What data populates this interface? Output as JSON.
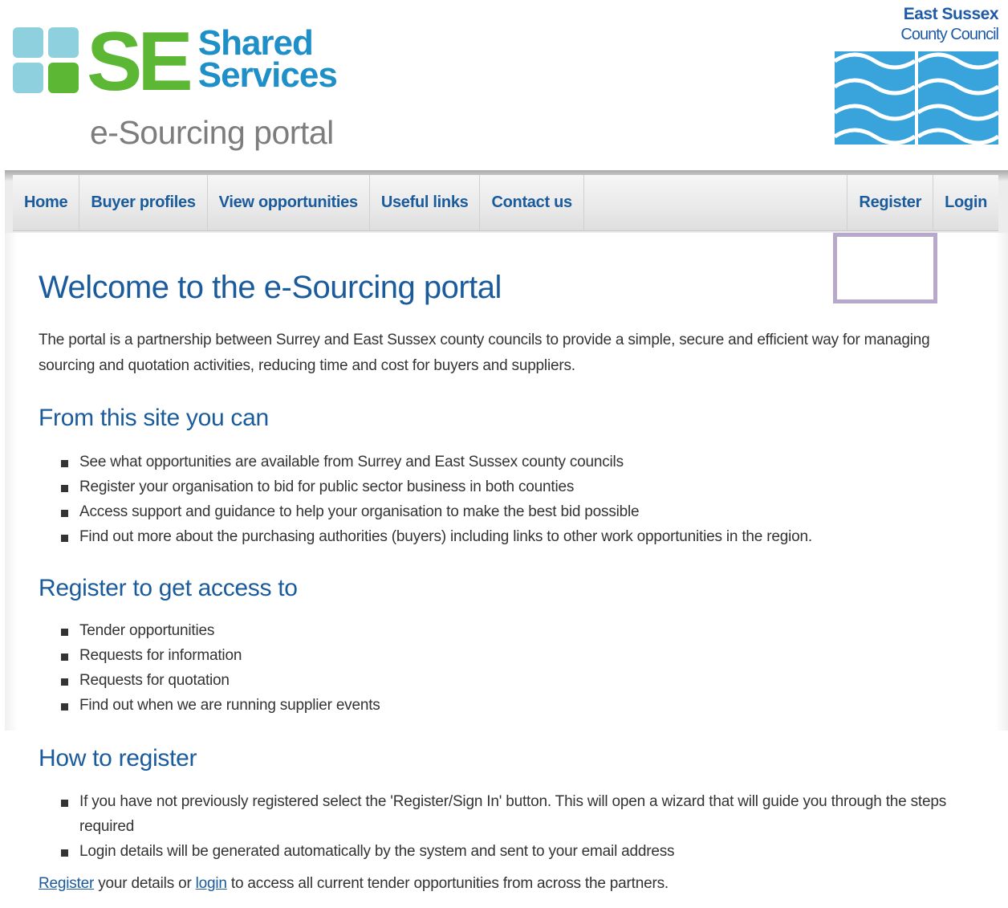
{
  "header": {
    "logo_letters": "SE",
    "logo_word1": "Shared",
    "logo_word2": "Services",
    "subtitle": "e-Sourcing portal",
    "partner_name_line1": "East Sussex",
    "partner_name_line2": "County Council"
  },
  "nav": {
    "left": [
      "Home",
      "Buyer profiles",
      "View opportunities",
      "Useful links",
      "Contact us"
    ],
    "right": [
      "Register",
      "Login"
    ]
  },
  "main": {
    "title": "Welcome to the e-Sourcing portal",
    "intro": "The portal is a partnership between Surrey and East Sussex county councils to provide a simple, secure and efficient way for managing sourcing and quotation activities, reducing time and cost for buyers and suppliers.",
    "sections": [
      {
        "heading": "From this site you can",
        "items": [
          "See what opportunities are available from Surrey and East Sussex county councils",
          "Register your organisation to bid for public sector business in both counties",
          "Access support and guidance to help your organisation to make the best bid possible",
          "Find out more about the purchasing authorities (buyers) including links to other work opportunities in the region."
        ]
      },
      {
        "heading": "Register to get access to",
        "items": [
          "Tender opportunities",
          "Requests for information",
          "Requests for quotation",
          "Find out when we are running supplier events"
        ]
      },
      {
        "heading": "How to register",
        "items": [
          "If you have not previously registered select the 'Register/Sign In' button. This will open a wizard that will guide you through the steps required",
          "Login details will be generated automatically by the system and sent to your email address"
        ]
      }
    ],
    "footer": {
      "register_link": "Register",
      "middle_text": " your details or ",
      "login_link": "login",
      "end_text": " to access all current tender opportunities from across the partners."
    }
  },
  "colors": {
    "brand_green": "#5bb734",
    "brand_blue": "#1f8fc7",
    "link_blue": "#1a5b9c",
    "highlight": "#b7a8cc"
  }
}
